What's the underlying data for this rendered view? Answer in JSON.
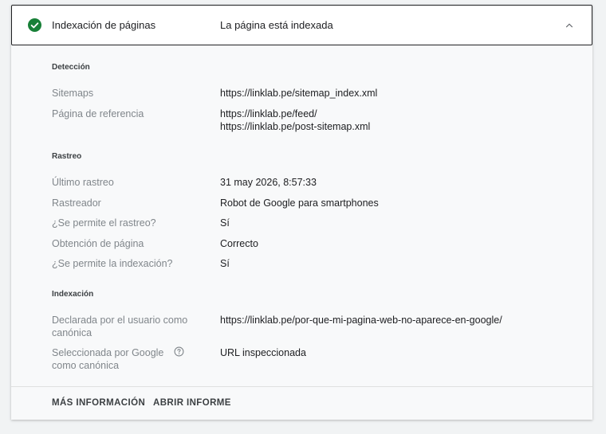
{
  "header": {
    "title": "Indexación de páginas",
    "status": "La página está indexada",
    "status_color": "#188038"
  },
  "sections": {
    "deteccion": {
      "title": "Detección",
      "sitemaps_label": "Sitemaps",
      "sitemaps_value": "https://linklab.pe/sitemap_index.xml",
      "referencia_label": "Página de referencia",
      "referencia_values": [
        "https://linklab.pe/feed/",
        "https://linklab.pe/post-sitemap.xml"
      ]
    },
    "rastreo": {
      "title": "Rastreo",
      "ultimo_label": "Último rastreo",
      "ultimo_value": "31 may 2026, 8:57:33",
      "rastreador_label": "Rastreador",
      "rastreador_value": "Robot de Google para smartphones",
      "permite_rastreo_label": "¿Se permite el rastreo?",
      "permite_rastreo_value": "Sí",
      "obtencion_label": "Obtención de página",
      "obtencion_value": "Correcto",
      "permite_indexacion_label": "¿Se permite la indexación?",
      "permite_indexacion_value": "Sí"
    },
    "indexacion": {
      "title": "Indexación",
      "declarada_label_1": "Declarada por el usuario como",
      "declarada_label_2": "canónica",
      "declarada_value": "https://linklab.pe/por-que-mi-pagina-web-no-aparece-en-google/",
      "seleccionada_label_1": "Seleccionada por Google",
      "seleccionada_label_2": "como canónica",
      "seleccionada_value": "URL inspeccionada"
    }
  },
  "footer": {
    "mas_info": "MÁS INFORMACIÓN",
    "abrir_informe": "ABRIR INFORME"
  },
  "icons": {
    "status": "check-circle-icon",
    "collapse": "chevron-up-icon",
    "help": "help-circle-icon"
  }
}
